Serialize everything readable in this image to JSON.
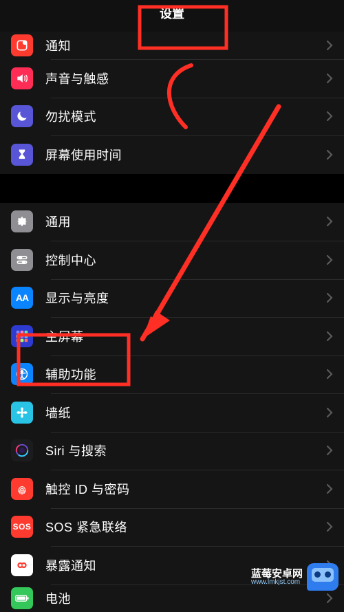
{
  "header": {
    "title": "设置"
  },
  "groupA": {
    "items": [
      {
        "id": "notifications",
        "label": "通知",
        "icon": "notifications",
        "iconBg": "#ff3b30"
      },
      {
        "id": "sounds",
        "label": "声音与触感",
        "icon": "speaker",
        "iconBg": "#ff2d55"
      },
      {
        "id": "dnd",
        "label": "勿扰模式",
        "icon": "moon",
        "iconBg": "#5856d6"
      },
      {
        "id": "screentime",
        "label": "屏幕使用时间",
        "icon": "hourglass",
        "iconBg": "#5856d6"
      }
    ]
  },
  "groupB": {
    "items": [
      {
        "id": "general",
        "label": "通用",
        "icon": "gear",
        "iconBg": "#8e8e93"
      },
      {
        "id": "controlcenter",
        "label": "控制中心",
        "icon": "sliders",
        "iconBg": "#8e8e93"
      },
      {
        "id": "display",
        "label": "显示与亮度",
        "icon": "aa",
        "iconBg": "#0a84ff"
      },
      {
        "id": "homescreen",
        "label": "主屏幕",
        "icon": "grid",
        "iconBg": "#2e3bd1"
      },
      {
        "id": "accessibility",
        "label": "辅助功能",
        "icon": "person",
        "iconBg": "#0a84ff"
      },
      {
        "id": "wallpaper",
        "label": "墙纸",
        "icon": "flower",
        "iconBg": "#29c3e6"
      },
      {
        "id": "siri",
        "label": "Siri 与搜索",
        "icon": "siri",
        "iconBg": "#1c1c1e"
      },
      {
        "id": "touchid",
        "label": "触控 ID 与密码",
        "icon": "fingerprint",
        "iconBg": "#ff3b30"
      },
      {
        "id": "sos",
        "label": "SOS 紧急联络",
        "icon": "sos",
        "iconBg": "#ff3b30"
      },
      {
        "id": "exposure",
        "label": "暴露通知",
        "icon": "exposure",
        "iconBg": "#ffffff"
      },
      {
        "id": "battery",
        "label": "电池",
        "icon": "battery",
        "iconBg": "#34c759"
      }
    ]
  },
  "annotation": {
    "color": "#ff2f25",
    "highlight1_label": "设置",
    "highlight2_label": "辅助功能"
  },
  "watermark": {
    "line1": "蓝莓安卓网",
    "line2": "www.lmkjst.com"
  }
}
